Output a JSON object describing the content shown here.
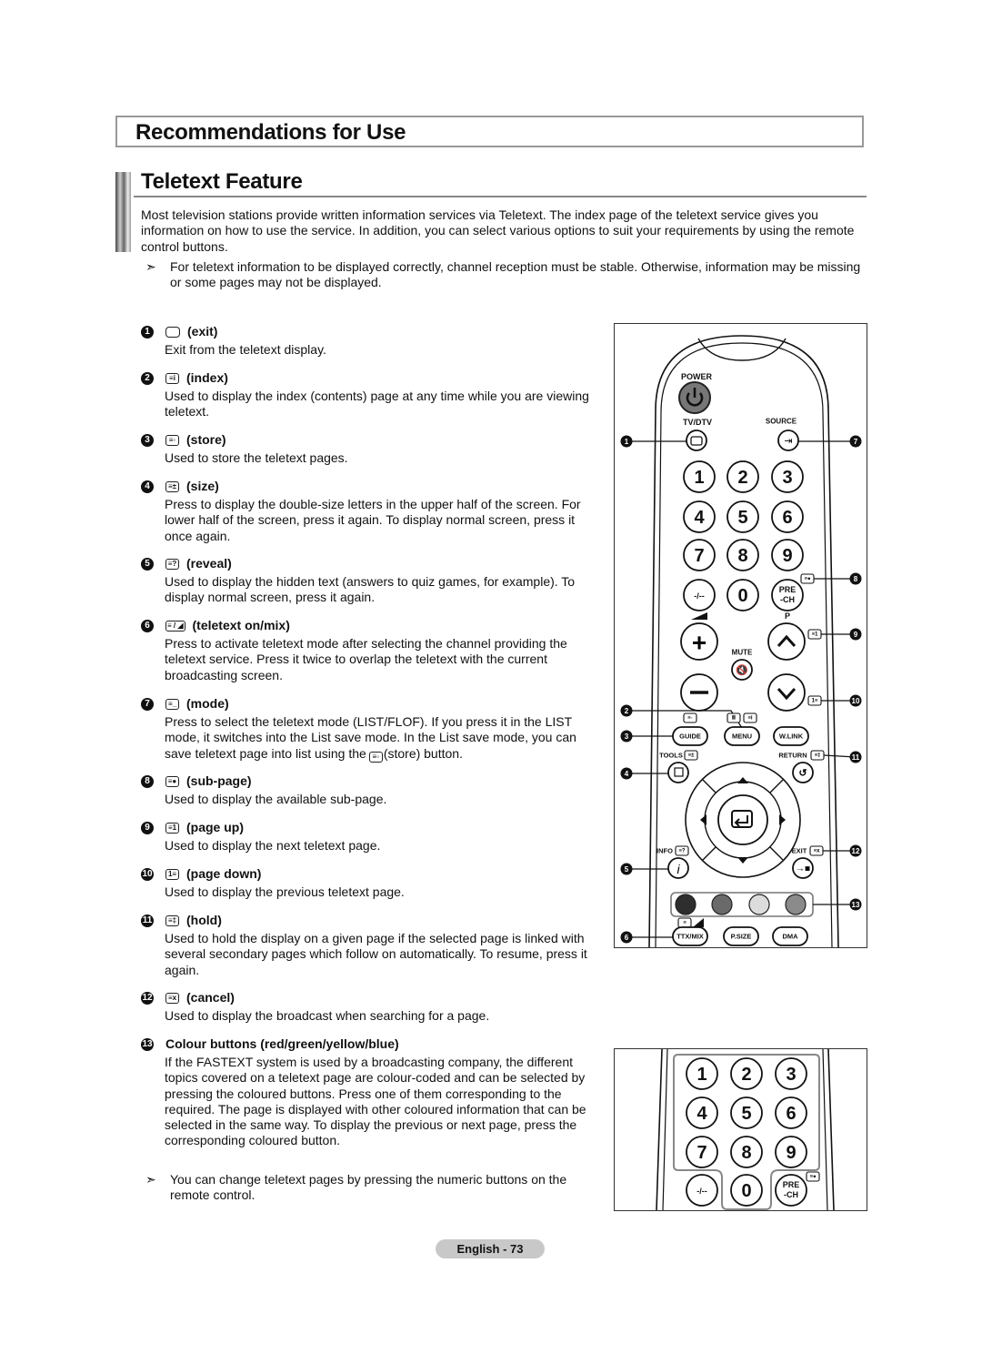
{
  "section_title": "Recommendations for Use",
  "heading": "Teletext Feature",
  "intro": "Most television stations provide written information services via Teletext. The index page of the teletext service gives you information on how to use the service. In addition, you can select various options to suit your requirements by using the remote control buttons.",
  "note1": "For teletext information to be displayed correctly, channel reception must be stable. Otherwise, information may be missing or some pages may not be displayed.",
  "note_arrow": "➣",
  "items": [
    {
      "num": "1",
      "icon": "exit-icon",
      "label": "(exit)",
      "desc": "Exit from the teletext display."
    },
    {
      "num": "2",
      "icon": "index-icon",
      "label": "(index)",
      "desc": "Used to display the index (contents) page at any time while you are viewing teletext."
    },
    {
      "num": "3",
      "icon": "store-icon",
      "label": "(store)",
      "desc": "Used to store the teletext pages."
    },
    {
      "num": "4",
      "icon": "size-icon",
      "label": "(size)",
      "desc": "Press to display the double-size letters in the upper half of the screen. For lower half of the screen, press it again. To display normal screen, press it once again."
    },
    {
      "num": "5",
      "icon": "reveal-icon",
      "label": "(reveal)",
      "desc": "Used to display the hidden text (answers to quiz games, for example). To display normal screen, press it again."
    },
    {
      "num": "6",
      "icon": "teletext-mix-icon",
      "label": "(teletext on/mix)",
      "desc": "Press to activate teletext mode after selecting the channel providing the teletext service. Press it twice to overlap the teletext with the current broadcasting screen."
    },
    {
      "num": "7",
      "icon": "mode-icon",
      "label": "(mode)",
      "desc": "Press to select the teletext mode (LIST/FLOF). If you press it in the LIST mode, it switches into the List save mode. In the List save mode, you can save teletext page into list using the",
      "desc_tail": "(store) button."
    },
    {
      "num": "8",
      "icon": "sub-page-icon",
      "label": "(sub-page)",
      "desc": "Used to display the available sub-page."
    },
    {
      "num": "9",
      "icon": "page-up-icon",
      "label": "(page up)",
      "desc": "Used to display the next teletext page."
    },
    {
      "num": "10",
      "icon": "page-down-icon",
      "label": "(page down)",
      "desc": "Used to display the previous teletext page."
    },
    {
      "num": "11",
      "icon": "hold-icon",
      "label": "(hold)",
      "desc": "Used to hold the display on a given page if the selected page is linked with several secondary pages which follow on automatically. To resume, press it again."
    },
    {
      "num": "12",
      "icon": "cancel-icon",
      "label": "(cancel)",
      "desc": "Used to display the broadcast when searching for a page."
    },
    {
      "num": "13",
      "icon": "",
      "label": "Colour buttons (red/green/yellow/blue)",
      "desc": "If the FASTEXT system is used by a broadcasting company, the different topics covered on a teletext page are colour-coded and can be selected by pressing the coloured buttons. Press one of them corresponding to the required. The page is displayed with other coloured information that can be selected in the same way. To display the previous or next page, press the corresponding coloured button."
    }
  ],
  "note2": "You can change teletext pages by pressing the numeric buttons on the remote control.",
  "remote": {
    "power": "POWER",
    "tv_dtv": "TV/DTV",
    "source": "SOURCE",
    "digits": [
      "1",
      "2",
      "3",
      "4",
      "5",
      "6",
      "7",
      "8",
      "9",
      "0"
    ],
    "dash": "-/--",
    "pre": "PRE",
    "ch": "-CH",
    "p": "P",
    "mute": "MUTE",
    "guide": "GUIDE",
    "menu": "MENU",
    "wlink": "W.LINK",
    "tools": "TOOLS",
    "return": "RETURN",
    "info": "INFO",
    "exit": "EXIT",
    "ttx": "TTX/MIX",
    "psize": "P.SIZE",
    "dma": "DMA",
    "color_buttons": [
      "#2e2e2e",
      "#6a6a6a",
      "#dcdcdc",
      "#8a8a8a"
    ],
    "callouts": [
      "1",
      "7",
      "8",
      "9",
      "10",
      "2",
      "3",
      "11",
      "4",
      "12",
      "5",
      "13",
      "6"
    ]
  },
  "footer": "English - 73"
}
